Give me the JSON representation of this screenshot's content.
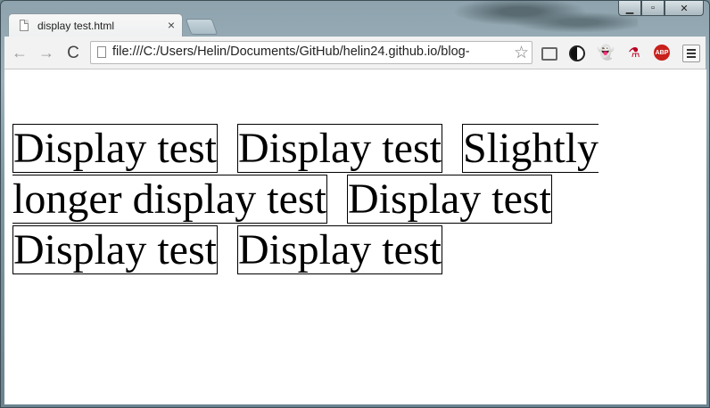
{
  "tab": {
    "title": "display test.html",
    "close": "×"
  },
  "window_controls": {
    "minimize": "▁",
    "maximize": "▫",
    "close": "✕"
  },
  "toolbar": {
    "back": "←",
    "forward": "→",
    "reload": "C",
    "url": "file:///C:/Users/Helin/Documents/GitHub/helin24.github.io/blog-",
    "star": "☆"
  },
  "extensions": {
    "abp_label": "ABP",
    "ghost": "👻"
  },
  "content": {
    "boxes": [
      "Display test",
      "Display test",
      "Slightly longer display test",
      "Display test",
      "Display test",
      "Display test"
    ]
  }
}
